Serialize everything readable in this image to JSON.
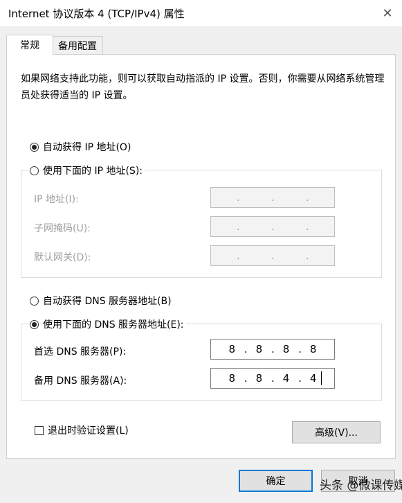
{
  "window": {
    "title": "Internet 协议版本 4 (TCP/IPv4) 属性",
    "close_glyph": "✕"
  },
  "tabs": [
    {
      "label": "常规",
      "active": true
    },
    {
      "label": "备用配置",
      "active": false
    }
  ],
  "description": "如果网络支持此功能，则可以获取自动指派的 IP 设置。否则，你需要从网络系统管理员处获得适当的 IP 设置。",
  "ip_section": {
    "auto_label": "自动获得 IP 地址(O)",
    "manual_label": "使用下面的 IP 地址(S):",
    "selected": "auto",
    "ip_address_label": "IP 地址(I):",
    "subnet_label": "子网掩码(U):",
    "gateway_label": "默认网关(D):",
    "empty_sep": "."
  },
  "dns_section": {
    "auto_label": "自动获得 DNS 服务器地址(B)",
    "manual_label": "使用下面的 DNS 服务器地址(E):",
    "selected": "manual",
    "preferred_label": "首选 DNS 服务器(P):",
    "alternate_label": "备用 DNS 服务器(A):",
    "preferred_octets": [
      "8",
      "8",
      "8",
      "8"
    ],
    "alternate_octets": [
      "8",
      "8",
      "4",
      "4"
    ],
    "sep": "."
  },
  "validate_label": "退出时验证设置(L)",
  "advanced_button": "高级(V)...",
  "ok_button": "确定",
  "cancel_button": "取消",
  "watermark": "头条 @微课传媒",
  "colors": {
    "accent": "#0078d7",
    "disabled_text": "#a0a0a0"
  }
}
